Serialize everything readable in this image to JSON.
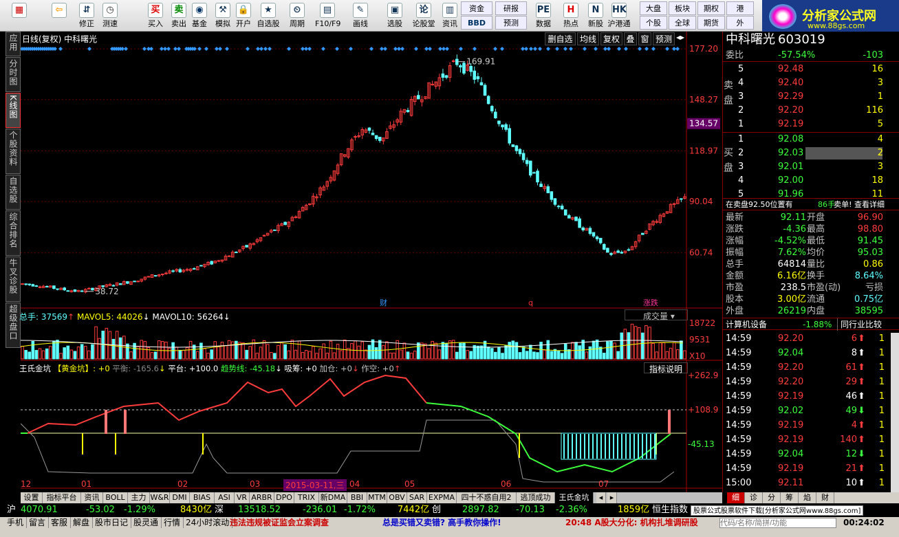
{
  "toolbar": {
    "buttons": [
      {
        "label": "",
        "icon": "windows-icon"
      },
      {
        "label": "",
        "icon": "back-arrow-icon"
      },
      {
        "label": "修正",
        "icon": "up-down-icon"
      },
      {
        "label": "测速",
        "icon": "clock-icon"
      },
      {
        "label": "买入",
        "icon": "buy-icon"
      },
      {
        "label": "卖出",
        "icon": "sell-icon"
      },
      {
        "label": "基金",
        "icon": "fund-icon"
      },
      {
        "label": "模拟",
        "icon": "hammer-icon"
      },
      {
        "label": "开户",
        "icon": "lock-icon"
      },
      {
        "label": "自选股",
        "icon": "star-icon"
      },
      {
        "label": "周期",
        "icon": "period-icon"
      },
      {
        "label": "F10/F9",
        "icon": "f10-icon"
      },
      {
        "label": "画线",
        "icon": "pen-icon"
      },
      {
        "label": "选股",
        "icon": "select-icon"
      },
      {
        "label": "论股堂",
        "icon": "forum-icon"
      },
      {
        "label": "资讯",
        "icon": "news-icon"
      },
      {
        "label": "数据",
        "icon": "pe-icon"
      },
      {
        "label": "热点",
        "icon": "hot-icon"
      },
      {
        "label": "新股",
        "icon": "new-stock-icon"
      },
      {
        "label": "沪港通",
        "icon": "hk-icon"
      }
    ],
    "group_a": {
      "top": "资金",
      "bottom": "BBD"
    },
    "group_b": {
      "top": "研报",
      "bottom": "预测"
    },
    "group_c": {
      "r1": [
        "大盘",
        "板块",
        "期权",
        "港"
      ],
      "r2": [
        "个股",
        "全球",
        "期货",
        "外"
      ]
    }
  },
  "logo": {
    "title": "分析家公式网",
    "url": "www.88gs.com"
  },
  "left_tabs": [
    "应用",
    "分时图",
    "K线图",
    "个股资料",
    "自选股",
    "综合排名",
    "牛叉诊股",
    "超级盘口"
  ],
  "chart": {
    "header": "日线(复权)  中科曙光",
    "buttons": [
      "删自选",
      "均线",
      "复权",
      "叠",
      "窗",
      "预测"
    ],
    "price_axis": [
      "177.20",
      "148.27",
      "118.97",
      "90.04",
      "60.74"
    ],
    "current_price_tag": "134.57",
    "high_label": "169.91",
    "low_label": "38.72",
    "event_marks": [
      "财",
      "q",
      "涨跌"
    ],
    "volume": {
      "text": "总手: 37569",
      "mavol5": "MAVOL5: 44026",
      "mavol10": "MAVOL10: 56264",
      "dropdown": "成交量",
      "axis": [
        "18722",
        "9531",
        "X10"
      ]
    },
    "indicator": {
      "name": "王氏金坑",
      "sub": "【黄金坑】: +0",
      "pinghe": "平衡: -165.6",
      "pingtai": "平台: +100.0",
      "trend": "趋势线: -45.18",
      "xichou": "吸筹: +0",
      "jiacang": "加仓: +0",
      "zuokong": "作空: +0",
      "help": "指标说明",
      "axis": [
        "+262.9",
        "+108.9",
        "-45.13"
      ]
    },
    "months": [
      "12",
      "01",
      "02",
      "03",
      "2015-03-11,三",
      "04",
      "05",
      "06",
      "07"
    ]
  },
  "chart_data": {
    "type": "candlestick",
    "title": "日线(复权)  中科曙光",
    "ylim": [
      38.72,
      177.2
    ],
    "categories": [
      "12",
      "01",
      "02",
      "03",
      "04",
      "05",
      "06",
      "07"
    ],
    "annotations": {
      "high": 169.91,
      "low": 38.72,
      "last": 134.57
    },
    "close": [
      43,
      42,
      40,
      38.7,
      41,
      43,
      45,
      48,
      50,
      52,
      55,
      60,
      65,
      72,
      78,
      88,
      100,
      118,
      132,
      125,
      140,
      150,
      160,
      170,
      160,
      140,
      120,
      105,
      92,
      80,
      72,
      60,
      62,
      75,
      85,
      92
    ]
  },
  "quote": {
    "name": "中科曙光",
    "code": "603019",
    "weibi": {
      "label": "委比",
      "pct": "-57.54%",
      "diff": "-103"
    },
    "sell": [
      {
        "lv": "5",
        "p": "92.48",
        "v": "16"
      },
      {
        "lv": "4",
        "p": "92.40",
        "v": "3"
      },
      {
        "lv": "3",
        "p": "92.29",
        "v": "1"
      },
      {
        "lv": "2",
        "p": "92.20",
        "v": "116"
      },
      {
        "lv": "1",
        "p": "92.19",
        "v": "5"
      }
    ],
    "buy": [
      {
        "lv": "1",
        "p": "92.08",
        "v": "4"
      },
      {
        "lv": "2",
        "p": "92.03",
        "v": "2"
      },
      {
        "lv": "3",
        "p": "92.01",
        "v": "3"
      },
      {
        "lv": "4",
        "p": "92.00",
        "v": "18"
      },
      {
        "lv": "5",
        "p": "91.96",
        "v": "11"
      }
    ],
    "sell_label": "卖盘",
    "buy_label": "买盘",
    "notice": "在卖盘92.50位置有",
    "notice_qty": "86手",
    "notice_link": "卖单! 查看详细",
    "stats": [
      [
        "最新",
        "92.11",
        "开盘",
        "96.90"
      ],
      [
        "涨跌",
        "-4.36",
        "最高",
        "98.80"
      ],
      [
        "涨幅",
        "-4.52%",
        "最低",
        "91.45"
      ],
      [
        "振幅",
        "7.62%",
        "均价",
        "95.03"
      ],
      [
        "总手",
        "64814",
        "量比",
        "0.86"
      ],
      [
        "金额",
        "6.16亿",
        "换手",
        "8.64%"
      ],
      [
        "市盈",
        "238.5",
        "市盈(动)",
        "亏损"
      ],
      [
        "股本",
        "3.00亿",
        "流通",
        "0.75亿"
      ],
      [
        "外盘",
        "26219",
        "内盘",
        "38595"
      ]
    ],
    "industry": {
      "name": "计算机设备",
      "pct": "-1.88%",
      "btn": "同行业比较"
    },
    "ticks": [
      [
        "14:59",
        "92.20",
        "6",
        "1"
      ],
      [
        "14:59",
        "92.04",
        "8",
        "1"
      ],
      [
        "14:59",
        "92.20",
        "61",
        "1"
      ],
      [
        "14:59",
        "92.20",
        "29",
        "1"
      ],
      [
        "14:59",
        "92.19",
        "46",
        "1"
      ],
      [
        "14:59",
        "92.02",
        "49",
        "1"
      ],
      [
        "14:59",
        "92.19",
        "4",
        "1"
      ],
      [
        "14:59",
        "92.19",
        "140",
        "1"
      ],
      [
        "14:59",
        "92.04",
        "12",
        "1"
      ],
      [
        "14:59",
        "92.19",
        "21",
        "1"
      ],
      [
        "15:00",
        "92.11",
        "10",
        "1"
      ]
    ]
  },
  "bottom_tabs": [
    "设置",
    "指标平台",
    "资讯",
    "BOLL",
    "主力",
    "W&R",
    "DMI",
    "BIAS",
    "ASI",
    "VR",
    "ARBR",
    "DPO",
    "TRIX",
    "新DMA",
    "BBI",
    "MTM",
    "OBV",
    "SAR",
    "EXPMA",
    "四十不惑自用2",
    "逃顶成功",
    "王氏金坑"
  ],
  "right_tabs": [
    "细",
    "诊",
    "分",
    "筹",
    "焰",
    "财"
  ],
  "status": {
    "sh": "沪",
    "sh_val": "4070.91",
    "sh_chg": "-53.02",
    "sh_pct": "-1.29%",
    "sh_amt": "8430亿",
    "sz": "深",
    "sz_val": "13518.52",
    "sz_chg": "-236.01",
    "sz_pct": "-1.72%",
    "sz_amt": "7442亿",
    "cy": "创",
    "cy_val": "2897.82",
    "cy_chg": "-70.13",
    "cy_pct": "-2.36%",
    "cy_amt": "1859亿",
    "hs": "恒生指数",
    "links": [
      "手机",
      "留言",
      "客服",
      "解盘",
      "股市日记",
      "股灵通",
      "行情",
      "24小时滚动"
    ],
    "news1": "违法违规被证监会立案调查",
    "news2": "总是买错又卖错? 高手教你操作!",
    "news3": "20:48 A股大分化: 机构扎堆调研股",
    "ad": "股票公式股票软件下载[分析家公式网www.88gs.com]",
    "search_placeholder": "代码/名称/简拼/功能",
    "clock": "00:24:02"
  }
}
